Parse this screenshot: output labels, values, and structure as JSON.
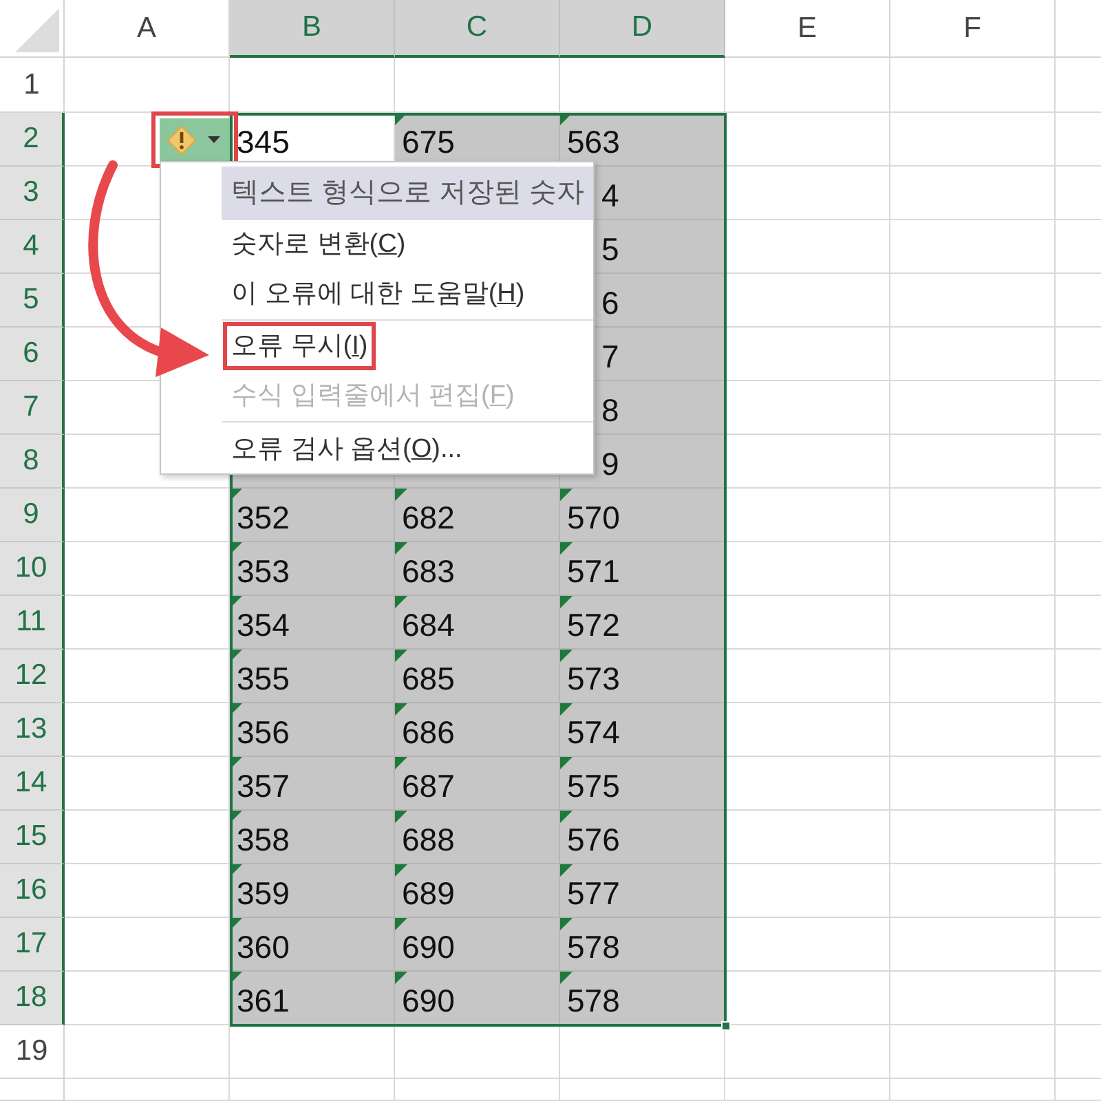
{
  "columns": [
    {
      "label": "A",
      "selected": false
    },
    {
      "label": "B",
      "selected": true
    },
    {
      "label": "C",
      "selected": true
    },
    {
      "label": "D",
      "selected": true
    },
    {
      "label": "E",
      "selected": false
    },
    {
      "label": "F",
      "selected": false
    }
  ],
  "rows": [
    {
      "label": "1",
      "selected": false
    },
    {
      "label": "2",
      "selected": true,
      "cells": [
        {
          "text": "345",
          "active": true
        },
        {
          "text": "675",
          "error_marker": true
        },
        {
          "text": "563",
          "error_marker": true
        }
      ]
    },
    {
      "label": "3",
      "selected": true,
      "cells": [
        {},
        {},
        {
          "text": "4",
          "kind": "partly_covered"
        }
      ]
    },
    {
      "label": "4",
      "selected": true,
      "cells": [
        {},
        {},
        {
          "text": "5",
          "kind": "partly_covered"
        }
      ]
    },
    {
      "label": "5",
      "selected": true,
      "cells": [
        {},
        {},
        {
          "text": "6",
          "kind": "partly_covered"
        }
      ]
    },
    {
      "label": "6",
      "selected": true,
      "cells": [
        {},
        {},
        {
          "text": "7",
          "kind": "partly_covered"
        }
      ]
    },
    {
      "label": "7",
      "selected": true,
      "cells": [
        {},
        {},
        {
          "text": "8",
          "kind": "partly_covered"
        }
      ]
    },
    {
      "label": "8",
      "selected": true,
      "cells": [
        {},
        {},
        {
          "text": "9",
          "kind": "partly_covered"
        }
      ]
    },
    {
      "label": "9",
      "selected": true,
      "cells": [
        {
          "text": "352",
          "error_marker": true
        },
        {
          "text": "682",
          "error_marker": true
        },
        {
          "text": "570",
          "error_marker": true
        }
      ]
    },
    {
      "label": "10",
      "selected": true,
      "cells": [
        {
          "text": "353",
          "error_marker": true
        },
        {
          "text": "683",
          "error_marker": true
        },
        {
          "text": "571",
          "error_marker": true
        }
      ]
    },
    {
      "label": "11",
      "selected": true,
      "cells": [
        {
          "text": "354",
          "error_marker": true
        },
        {
          "text": "684",
          "error_marker": true
        },
        {
          "text": "572",
          "error_marker": true
        }
      ]
    },
    {
      "label": "12",
      "selected": true,
      "cells": [
        {
          "text": "355",
          "error_marker": true
        },
        {
          "text": "685",
          "error_marker": true
        },
        {
          "text": "573",
          "error_marker": true
        }
      ]
    },
    {
      "label": "13",
      "selected": true,
      "cells": [
        {
          "text": "356",
          "error_marker": true
        },
        {
          "text": "686",
          "error_marker": true
        },
        {
          "text": "574",
          "error_marker": true
        }
      ]
    },
    {
      "label": "14",
      "selected": true,
      "cells": [
        {
          "text": "357",
          "error_marker": true
        },
        {
          "text": "687",
          "error_marker": true
        },
        {
          "text": "575",
          "error_marker": true
        }
      ]
    },
    {
      "label": "15",
      "selected": true,
      "cells": [
        {
          "text": "358",
          "error_marker": true
        },
        {
          "text": "688",
          "error_marker": true
        },
        {
          "text": "576",
          "error_marker": true
        }
      ]
    },
    {
      "label": "16",
      "selected": true,
      "cells": [
        {
          "text": "359",
          "error_marker": true
        },
        {
          "text": "689",
          "error_marker": true
        },
        {
          "text": "577",
          "error_marker": true
        }
      ]
    },
    {
      "label": "17",
      "selected": true,
      "cells": [
        {
          "text": "360",
          "error_marker": true
        },
        {
          "text": "690",
          "error_marker": true
        },
        {
          "text": "578",
          "error_marker": true
        }
      ]
    },
    {
      "label": "18",
      "selected": true,
      "cells": [
        {
          "text": "361",
          "error_marker": true
        },
        {
          "text": "690",
          "error_marker": true
        },
        {
          "text": "578",
          "error_marker": true
        }
      ]
    },
    {
      "label": "19",
      "selected": false
    }
  ],
  "error_button": {
    "expanded": true,
    "highlighted": true
  },
  "menu": [
    {
      "kind": "header",
      "label": "텍스트 형식으로 저장된 숫자"
    },
    {
      "kind": "item",
      "label": "숫자로 변환(",
      "access_key": "C",
      "after": ")",
      "disabled": false,
      "highlighted": false
    },
    {
      "kind": "item",
      "label": "이 오류에 대한 도움말(",
      "access_key": "H",
      "after": ")",
      "disabled": false,
      "highlighted": false
    },
    {
      "kind": "separator"
    },
    {
      "kind": "item",
      "label": "오류 무시(",
      "access_key": "I",
      "after": ")",
      "disabled": false,
      "highlighted": true
    },
    {
      "kind": "item",
      "label": "수식 입력줄에서 편집(",
      "access_key": "F",
      "after": ")",
      "disabled": true,
      "highlighted": false
    },
    {
      "kind": "separator"
    },
    {
      "kind": "item",
      "label": "오류 검사 옵션(",
      "access_key": "O",
      "after": ")...",
      "disabled": false,
      "highlighted": false
    }
  ],
  "annotation_arrow": true
}
